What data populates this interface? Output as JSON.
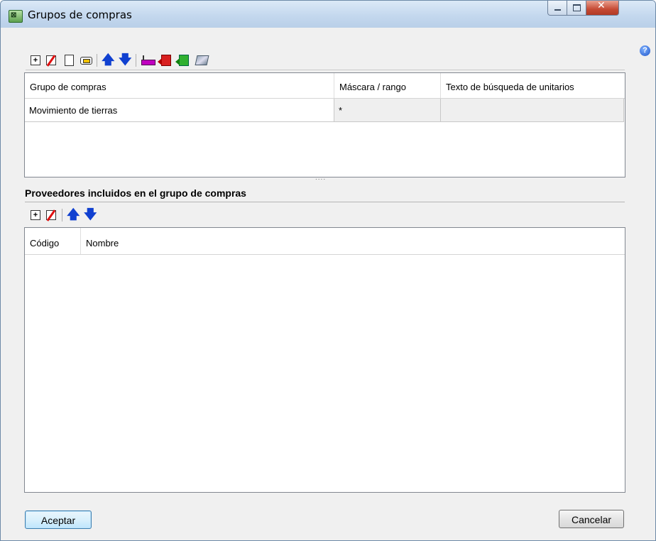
{
  "window": {
    "title": "Grupos de compras",
    "icon": "app-icon"
  },
  "caption": {
    "minimize": "minimize-icon",
    "maximize": "maximize-icon",
    "close": "✕"
  },
  "help_glyph": "?",
  "toolbar_top": {
    "icons": [
      "add-icon",
      "delete-icon",
      "copy-icon",
      "print-icon",
      "move-up-icon",
      "move-down-icon",
      "factory-icon",
      "export-red-icon",
      "export-green-icon",
      "tool-icon"
    ],
    "up_glyph": "🡅",
    "down_glyph": "🡇",
    "add_glyph": "+"
  },
  "groups_table": {
    "columns": [
      "Grupo de compras",
      "Máscara / rango",
      "Texto de búsqueda de unitarios"
    ],
    "rows": [
      {
        "grupo": "Movimiento de tierras",
        "mascara": "*",
        "texto": ""
      }
    ]
  },
  "splitter_glyph": "....",
  "suppliers_section": {
    "title": "Proveedores incluidos en el grupo de compras",
    "toolbar_icons": [
      "add-icon",
      "delete-icon",
      "move-up-icon",
      "move-down-icon"
    ],
    "columns": [
      "Código",
      "Nombre"
    ],
    "rows": []
  },
  "buttons": {
    "accept": "Aceptar",
    "cancel": "Cancelar"
  }
}
